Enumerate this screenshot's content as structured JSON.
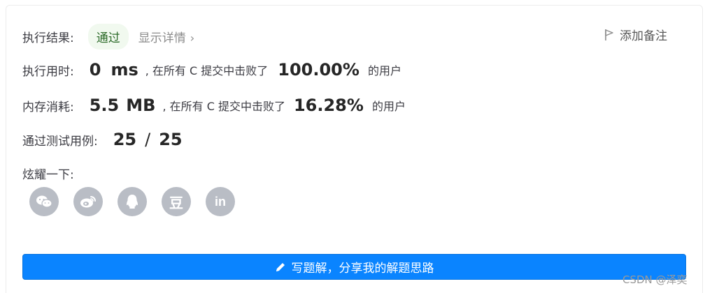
{
  "result": {
    "label": "执行结果:",
    "status": "通过",
    "details_link": "显示详情",
    "details_chevron": "›",
    "add_note": "添加备注"
  },
  "runtime": {
    "label": "执行用时:",
    "value": "0",
    "unit": "ms",
    "middle_text": ", 在所有 C 提交中击败了",
    "percent": "100.00%",
    "suffix": "的用户"
  },
  "memory": {
    "label": "内存消耗:",
    "value": "5.5",
    "unit": "MB",
    "middle_text": ", 在所有 C 提交中击败了",
    "percent": "16.28%",
    "suffix": "的用户"
  },
  "tests": {
    "label": "通过测试用例:",
    "passed": "25",
    "separator": "/",
    "total": "25"
  },
  "share": {
    "label": "炫耀一下:",
    "icons": [
      "wechat-icon",
      "weibo-icon",
      "qq-icon",
      "douban-icon",
      "linkedin-icon"
    ],
    "douban_glyph": "豆",
    "linkedin_glyph": "in"
  },
  "write_solution": {
    "label": "写题解，分享我的解题思路"
  },
  "watermark": "CSDN @泽奕",
  "colors": {
    "primary": "#0a84ff",
    "badge_bg": "#f1f9ef",
    "badge_text": "#2d6b2a",
    "icon_bg": "#b9bdc5"
  }
}
